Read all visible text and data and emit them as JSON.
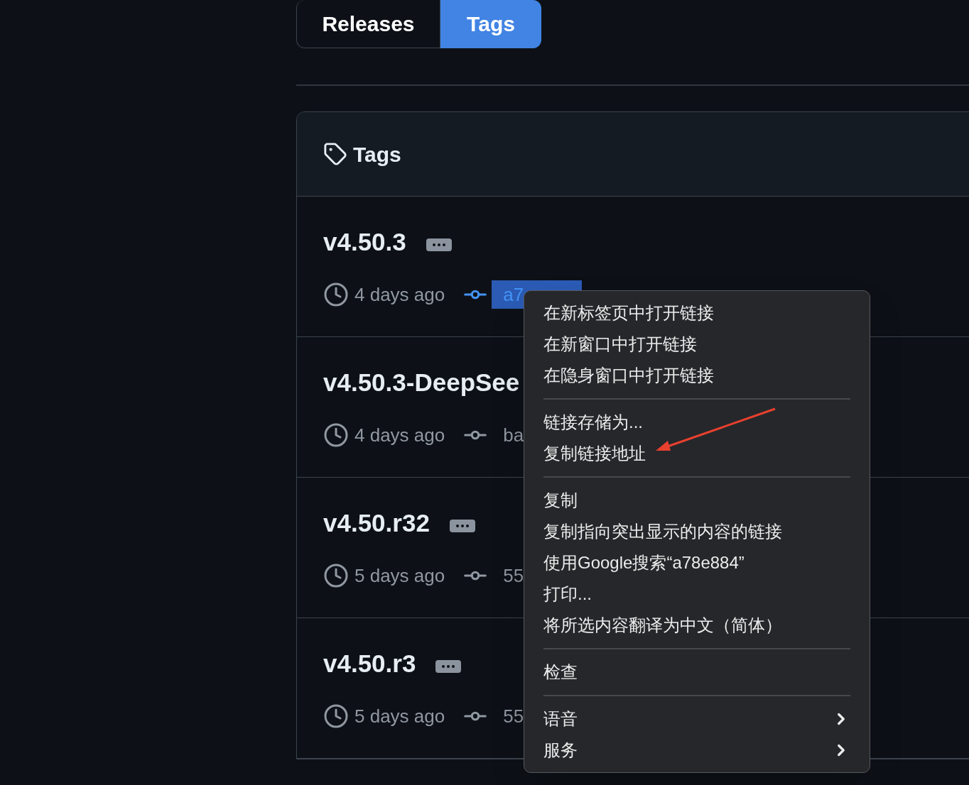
{
  "tabs": [
    {
      "label": "Releases",
      "selected": false
    },
    {
      "label": "Tags",
      "selected": true
    }
  ],
  "tags_panel": {
    "title": "Tags",
    "rows": [
      {
        "name": "v4.50.3",
        "badge": true,
        "time": "4 days ago",
        "commit": "a7",
        "commit_selected": true
      },
      {
        "name": "v4.50.3-DeepSee",
        "badge": false,
        "time": "4 days ago",
        "commit": "ba",
        "commit_selected": false
      },
      {
        "name": "v4.50.r32",
        "badge": true,
        "time": "5 days ago",
        "commit": "55",
        "commit_selected": false
      },
      {
        "name": "v4.50.r3",
        "badge": true,
        "time": "5 days ago",
        "commit": "55",
        "commit_selected": false
      }
    ]
  },
  "context_menu": {
    "groups": [
      [
        {
          "label": "在新标签页中打开链接",
          "submenu": false
        },
        {
          "label": "在新窗口中打开链接",
          "submenu": false
        },
        {
          "label": "在隐身窗口中打开链接",
          "submenu": false
        }
      ],
      [
        {
          "label": "链接存储为...",
          "submenu": false
        },
        {
          "label": "复制链接地址",
          "submenu": false
        }
      ],
      [
        {
          "label": "复制",
          "submenu": false
        },
        {
          "label": "复制指向突出显示的内容的链接",
          "submenu": false
        },
        {
          "label": "使用Google搜索“a78e884”",
          "submenu": false
        },
        {
          "label": "打印...",
          "submenu": false
        },
        {
          "label": "将所选内容翻译为中文（简体）",
          "submenu": false
        }
      ],
      [
        {
          "label": "检查",
          "submenu": false
        }
      ],
      [
        {
          "label": "语音",
          "submenu": true
        },
        {
          "label": "服务",
          "submenu": true
        }
      ]
    ]
  }
}
